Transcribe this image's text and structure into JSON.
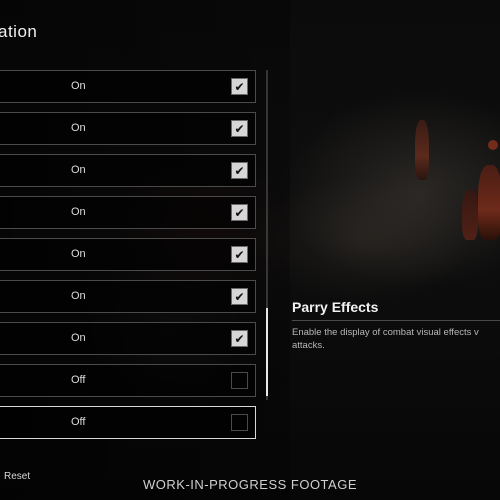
{
  "header": {
    "title": "ation"
  },
  "options": [
    {
      "value": "On",
      "checked": true
    },
    {
      "value": "On",
      "checked": true
    },
    {
      "value": "On",
      "checked": true
    },
    {
      "value": "On",
      "checked": true
    },
    {
      "value": "On",
      "checked": true
    },
    {
      "value": "On",
      "checked": true
    },
    {
      "value": "On",
      "checked": true
    },
    {
      "value": "Off",
      "checked": false
    },
    {
      "value": "Off",
      "checked": false
    }
  ],
  "selected_index": 8,
  "detail": {
    "title": "Parry Effects",
    "description": "Enable the display of combat visual effects v attacks."
  },
  "footer": {
    "reset_label": "Reset",
    "watermark": "WORK-IN-PROGRESS FOOTAGE"
  },
  "icons": {
    "checkbox_checked": "checkmark-icon"
  }
}
